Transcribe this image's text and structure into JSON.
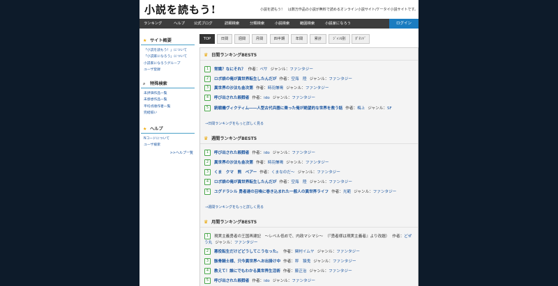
{
  "header": {
    "logo": "小説を読もう!",
    "tagline": "小説を読もう！　は数万作品の小説が無料で読めるオンライン小説サイト/ケータイ小説サイトです。"
  },
  "nav": {
    "items": [
      "ランキング",
      "ヘルプ",
      "公式ブログ",
      "詳細検索",
      "分類検索",
      "小説検索",
      "範囲検索",
      "小説家になろう"
    ],
    "login": "ログイン"
  },
  "sidebar": {
    "overview": {
      "title": "サイト概要",
      "links": [
        "「小説を読もう！」について",
        "「小説家になろう」について",
        "小説家になろうグループ",
        "ユーザ登録"
      ]
    },
    "special": {
      "title": "特殊検索",
      "links": [
        "未評価作品一覧",
        "未感想作品一覧",
        "平均点順作者一覧",
        "完結揃い"
      ]
    },
    "help": {
      "title": "ヘルプ",
      "links": [
        "Nコードについて",
        "ユーザ検索"
      ],
      "more": ">>ヘルプ一覧"
    }
  },
  "tabs": [
    "TOP",
    "日間",
    "週間",
    "月間",
    "四半期",
    "年間",
    "累計",
    "ｼﾞｬﾝﾙ別",
    "ﾀﾞﾈﾝﾄﾞ"
  ],
  "daily": {
    "title": "日間ランキングBEST5",
    "rows": [
      {
        "rank": "1",
        "title": "常識？なにそれ？",
        "author": "ベサ",
        "genre": "ファンタジー"
      },
      {
        "rank": "2",
        "title": "ロボ娘の俺が異世界転生したんだが",
        "author": "空海　陸",
        "genre": "ファンタジー"
      },
      {
        "rank": "3",
        "title": "異世界の沙汰も金次第",
        "author": "時羽兼鳴",
        "genre": "ファンタジー"
      },
      {
        "rank": "4",
        "title": "呼び出された殺戮者",
        "author": "ido",
        "genre": "ファンタジー"
      },
      {
        "rank": "5",
        "title": "銃戦機ヴィクティム――人型古代兵器に乗った俺が絶望的な世界を救う話",
        "author": "梅上",
        "genre": "SF"
      }
    ],
    "more": "→日間ランキングをもっと詳しく見る"
  },
  "weekly": {
    "title": "週間ランキングBEST5",
    "rows": [
      {
        "rank": "1",
        "title": "呼び出された殺戮者",
        "author": "ido",
        "genre": "ファンタジー"
      },
      {
        "rank": "2",
        "title": "異世界の沙汰も金次第",
        "author": "時羽兼鳴",
        "genre": "ファンタジー"
      },
      {
        "rank": "3",
        "title": "くま　クマ　熊　ベアー",
        "author": "くまなのだ～",
        "genre": "ファンタジー"
      },
      {
        "rank": "4",
        "title": "ロボ娘の俺が異世界転生したんだが",
        "author": "空海　陸",
        "genre": "ファンタジー"
      },
      {
        "rank": "5",
        "title": "ユグドラシル 勇者達の召喚に巻き込まれた一般人の異世界ライフ",
        "author": "光範",
        "genre": "ファンタジー"
      }
    ],
    "more": "→週間ランキングをもっと詳しく見る"
  },
  "monthly": {
    "title": "月間ランキングBEST5",
    "rows": [
      {
        "rank": "1",
        "title": "現実主義勇者の王国再建記　～レベル低めで、内政マシマシ～　（『勇者様は現実主義者』より改題）",
        "author": "どぜう丸",
        "genre": "ファンタジー"
      },
      {
        "rank": "2",
        "title": "悪役転生だけどどうしてこうなった。",
        "author": "関村イムヤ",
        "genre": "ファンタジー"
      },
      {
        "rank": "3",
        "title": "骸骨騎士様、只今異世界へお出掛け中",
        "author": "秤　猿鬼",
        "genre": "ファンタジー"
      },
      {
        "rank": "4",
        "title": "教えて！誰にでもわかる異世界生活術",
        "author": "藤正治",
        "genre": "ファンタジー"
      },
      {
        "rank": "5",
        "title": "呼び出された殺戮者",
        "author": "ido",
        "genre": "ファンタジー"
      }
    ]
  },
  "labels": {
    "author": "作者：",
    "genre": "ジャンル："
  },
  "colors": {
    "accent": "#1b7cc0",
    "nav_bg": "#3d3d3d",
    "link": "#1a55a0",
    "rank_green": "#2e8b2e",
    "page_bg": "#0d1b2a"
  }
}
